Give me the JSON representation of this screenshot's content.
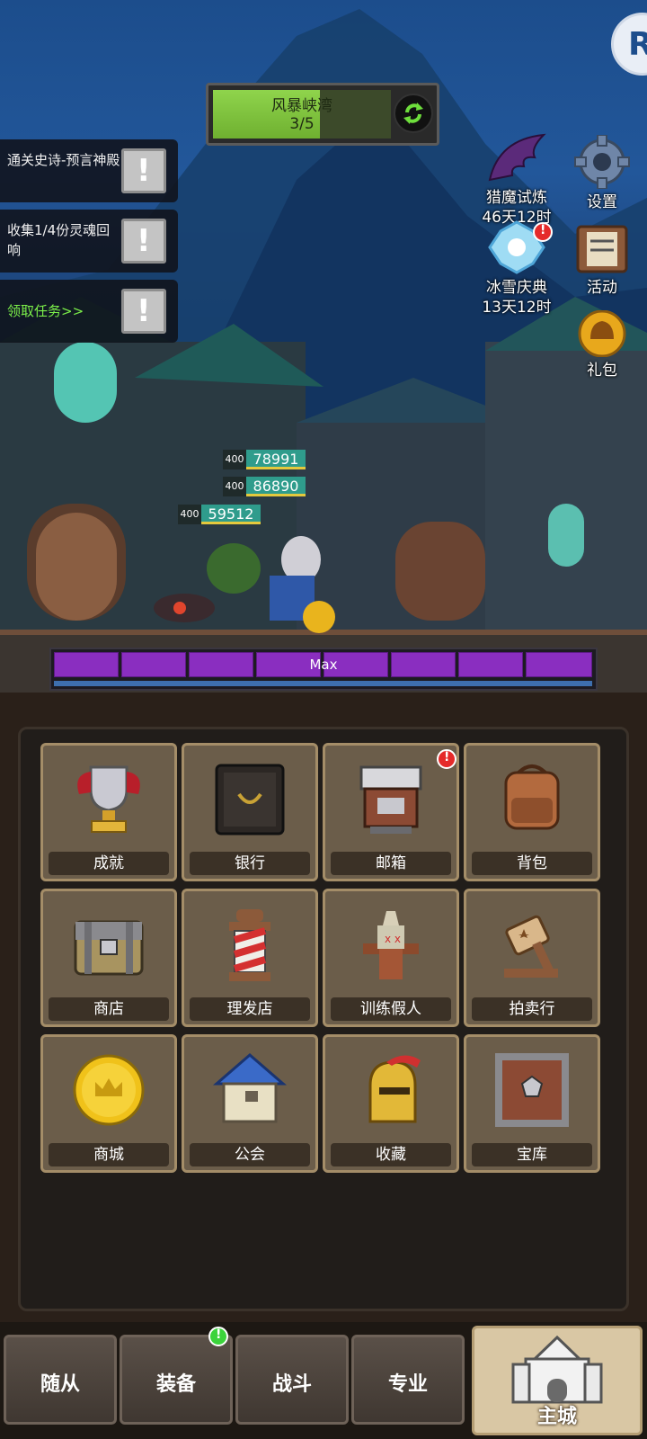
{
  "zone": {
    "name": "风暴峡湾",
    "progress_text": "3/5",
    "progress_fraction": 0.6
  },
  "quests": [
    {
      "text": "通关史诗-预言神殿",
      "mark": "!"
    },
    {
      "text": "收集1/4份灵魂回响",
      "mark": "!"
    },
    {
      "text": "领取任务>>",
      "mark": "!"
    }
  ],
  "events": {
    "demon_trial": {
      "label": "猎魔试炼",
      "timer": "46天12时"
    },
    "settings": {
      "label": "设置"
    },
    "snow_festival": {
      "label": "冰雪庆典",
      "timer": "13天12时",
      "badge": "!"
    },
    "activity": {
      "label": "活动"
    },
    "gift": {
      "label": "礼包"
    }
  },
  "party": [
    {
      "level": "400",
      "power": "78991"
    },
    {
      "level": "400",
      "power": "86890"
    },
    {
      "level": "400",
      "power": "59512"
    }
  ],
  "max_bar": {
    "label": "Max",
    "segments": 8
  },
  "menu": [
    {
      "label": "成就",
      "icon": "trophy-icon"
    },
    {
      "label": "银行",
      "icon": "bank-safe-icon"
    },
    {
      "label": "邮箱",
      "icon": "mailbox-icon",
      "badge": "!"
    },
    {
      "label": "背包",
      "icon": "backpack-icon"
    },
    {
      "label": "商店",
      "icon": "chest-icon"
    },
    {
      "label": "理发店",
      "icon": "barber-pole-icon"
    },
    {
      "label": "训练假人",
      "icon": "training-dummy-icon"
    },
    {
      "label": "拍卖行",
      "icon": "auction-hammer-icon"
    },
    {
      "label": "商城",
      "icon": "gold-coin-icon"
    },
    {
      "label": "公会",
      "icon": "guild-house-icon"
    },
    {
      "label": "收藏",
      "icon": "helmet-icon"
    },
    {
      "label": "宝库",
      "icon": "vault-icon"
    }
  ],
  "nav": [
    {
      "label": "随从"
    },
    {
      "label": "装备",
      "badge": "!"
    },
    {
      "label": "战斗"
    },
    {
      "label": "专业"
    },
    {
      "label": "主城",
      "active": true
    }
  ],
  "colors": {
    "zone_fill": "#8fd44c",
    "max_bar": "#8a2ec0",
    "badge_red": "#e52a2a",
    "badge_green": "#3bd33b"
  }
}
